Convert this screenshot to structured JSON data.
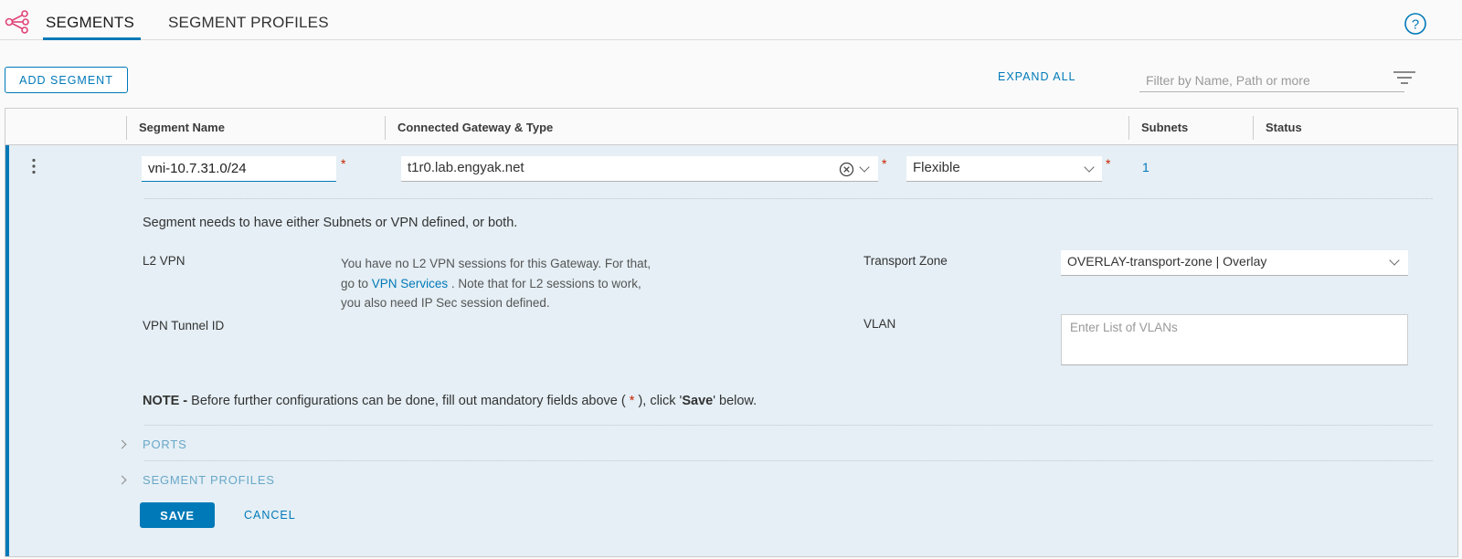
{
  "tabs": [
    {
      "label": "SEGMENTS",
      "active": true
    },
    {
      "label": "SEGMENT PROFILES",
      "active": false
    }
  ],
  "help_icon": "question-circle-icon",
  "app_icon": "network-nodes-icon",
  "toolbar": {
    "add_label": "ADD SEGMENT",
    "expand_label": "EXPAND ALL",
    "filter_placeholder": "Filter by Name, Path or more",
    "filter_icon": "filter-lines-icon"
  },
  "columns": [
    "Segment Name",
    "Connected Gateway & Type",
    "Subnets",
    "Status"
  ],
  "row": {
    "segment_name": "vni-10.7.31.0/24",
    "gateway": "t1r0.lab.engyak.net",
    "gateway_type": "Flexible",
    "subnets": "1",
    "required_mark": "*"
  },
  "details": {
    "info": "Segment needs to have either Subnets or VPN defined, or both.",
    "l2vpn_label": "L2 VPN",
    "l2vpn_text_1": "You have no L2 VPN sessions for this Gateway. For that,",
    "l2vpn_text_2_pre": "go to",
    "l2vpn_link": "VPN Services",
    "l2vpn_text_2_post": ". Note that for L2 sessions to work,",
    "l2vpn_text_3": "you also need IP Sec session defined.",
    "transport_zone_label": "Transport Zone",
    "transport_zone_value": "OVERLAY-transport-zone | Overlay",
    "vpn_tunnel_label": "VPN Tunnel ID",
    "vlan_label": "VLAN",
    "vlan_placeholder": "Enter List of VLANs",
    "note_bold": "NOTE -",
    "note_text_1": "Before further configurations can be done, fill out mandatory fields above (",
    "note_star": "*",
    "note_text_2": "), click '",
    "note_save": "Save",
    "note_text_3": "' below.",
    "ports_label": "PORTS",
    "profiles_label": "SEGMENT PROFILES",
    "save_label": "SAVE",
    "cancel_label": "CANCEL"
  },
  "colors": {
    "accent": "#0079b8",
    "required": "#c92100",
    "expanded_bg": "#e5eff5",
    "brand_icon": "#e04478"
  }
}
